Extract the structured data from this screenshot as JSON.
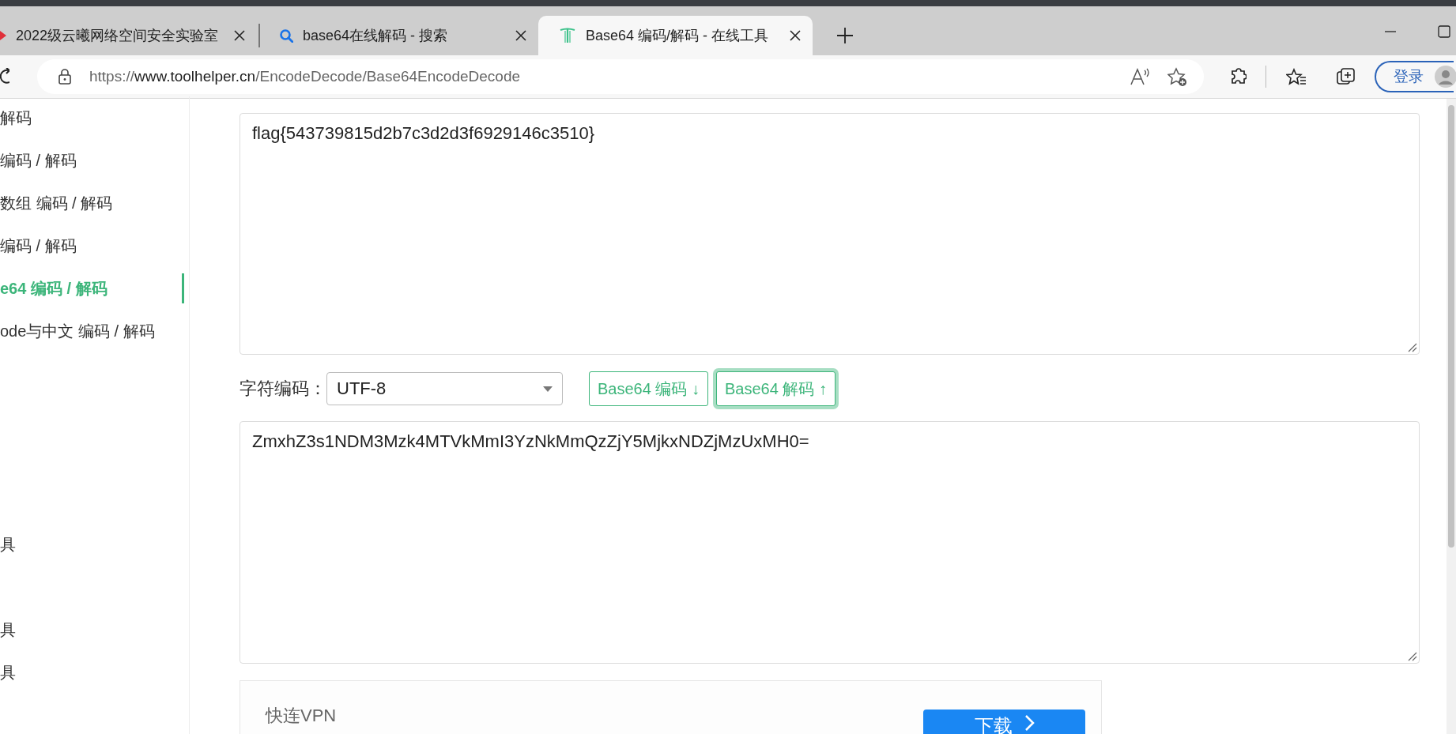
{
  "tabs": [
    {
      "title": "2022级云曦网络空间安全实验室",
      "kind": "arrow",
      "selected": false
    },
    {
      "title": "base64在线解码 - 搜索",
      "kind": "search",
      "selected": false
    },
    {
      "title": "Base64 编码/解码 - 在线工具",
      "kind": "logo",
      "selected": true
    }
  ],
  "address": {
    "scheme": "https://",
    "host": "www.toolhelper.cn",
    "path": "/EncodeDecode/Base64EncodeDecode"
  },
  "profile": {
    "login": "登录"
  },
  "sidebar": {
    "items": [
      {
        "text": "解码",
        "selected": false
      },
      {
        "text": "编码 / 解码",
        "selected": false
      },
      {
        "text": "数组 编码 / 解码",
        "selected": false
      },
      {
        "text": "编码 / 解码",
        "selected": false
      },
      {
        "text": "e64 编码 / 解码",
        "selected": true
      },
      {
        "text": "ode与中文 编码 / 解码",
        "selected": false
      },
      {
        "selected": false
      },
      {
        "selected": false
      },
      {
        "selected": false
      },
      {
        "selected": false
      },
      {
        "text": "具",
        "selected": false
      },
      {
        "selected": false
      },
      {
        "text": "具",
        "selected": false
      },
      {
        "text": "具",
        "selected": false
      },
      {
        "selected": false
      }
    ]
  },
  "codec": {
    "input": "flag{543739815d2b7c3d2d3f6929146c3510}",
    "charset_label": "字符编码：",
    "charset": "UTF-8",
    "buttons": [
      {
        "label": "Base64 编码 ↓",
        "focused": false
      },
      {
        "label": "Base64 解码 ↑",
        "focused": true
      }
    ],
    "output": "ZmxhZ3s1NDM3Mzk4MTVkMmI3YzNkMmQzZjY5MjkxNDZjMzUxMH0="
  },
  "ad": {
    "brand": "快连VPN",
    "button": "下载"
  }
}
